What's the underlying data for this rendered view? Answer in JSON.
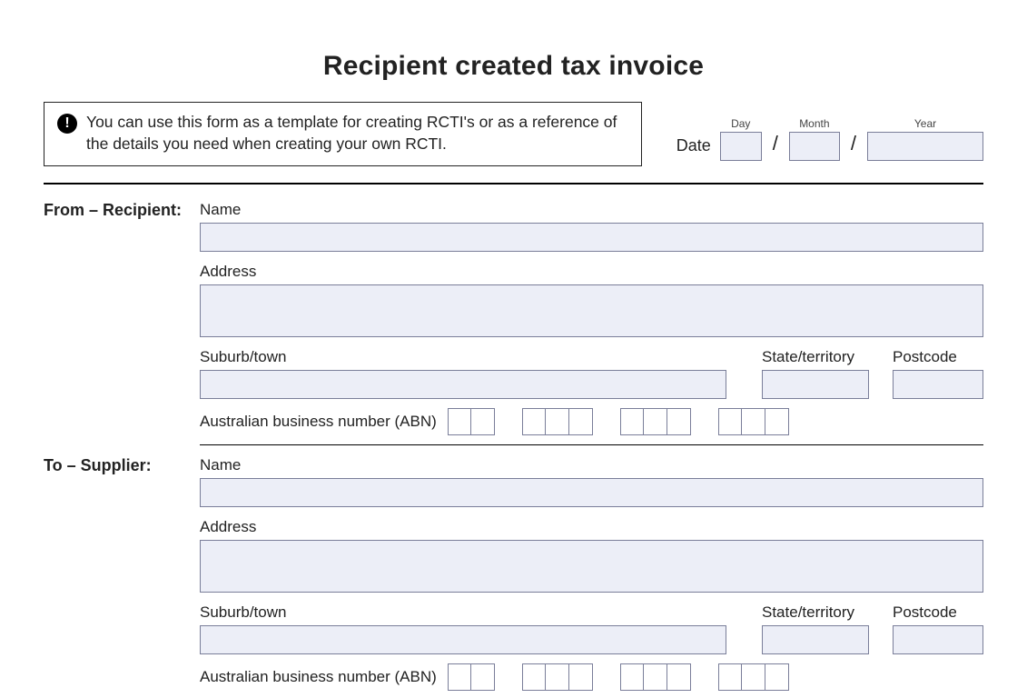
{
  "title": "Recipient created tax invoice",
  "notice": {
    "icon_glyph": "!",
    "text": "You can use this form as a template for creating RCTI's or as a reference of the details you need when creating your own RCTI."
  },
  "date": {
    "label": "Date",
    "day_label": "Day",
    "month_label": "Month",
    "year_label": "Year",
    "day": "",
    "month": "",
    "year": ""
  },
  "recipient": {
    "section_label": "From – Recipient:",
    "name_label": "Name",
    "name": "",
    "address_label": "Address",
    "address": "",
    "suburb_label": "Suburb/town",
    "suburb": "",
    "state_label": "State/territory",
    "state": "",
    "postcode_label": "Postcode",
    "postcode": "",
    "abn_label": "Australian business number (ABN)",
    "abn": [
      "",
      "",
      "",
      "",
      "",
      "",
      "",
      "",
      "",
      "",
      ""
    ]
  },
  "supplier": {
    "section_label": "To – Supplier:",
    "name_label": "Name",
    "name": "",
    "address_label": "Address",
    "address": "",
    "suburb_label": "Suburb/town",
    "suburb": "",
    "state_label": "State/territory",
    "state": "",
    "postcode_label": "Postcode",
    "postcode": "",
    "abn_label": "Australian business number (ABN)",
    "abn": [
      "",
      "",
      "",
      "",
      "",
      "",
      "",
      "",
      "",
      "",
      ""
    ]
  }
}
